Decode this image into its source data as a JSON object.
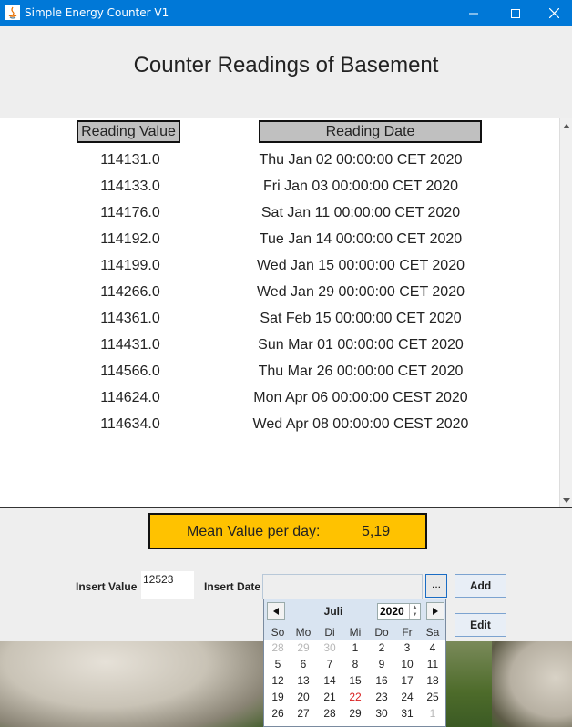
{
  "window": {
    "title": "Simple Energy Counter V1"
  },
  "header": {
    "title": "Counter Readings of Basement"
  },
  "table": {
    "headers": {
      "value": "Reading Value",
      "date": "Reading Date"
    },
    "rows": [
      {
        "value": "114131.0",
        "date": "Thu Jan 02 00:00:00 CET 2020"
      },
      {
        "value": "114133.0",
        "date": "Fri Jan 03 00:00:00 CET 2020"
      },
      {
        "value": "114176.0",
        "date": "Sat Jan 11 00:00:00 CET 2020"
      },
      {
        "value": "114192.0",
        "date": "Tue Jan 14 00:00:00 CET 2020"
      },
      {
        "value": "114199.0",
        "date": "Wed Jan 15 00:00:00 CET 2020"
      },
      {
        "value": "114266.0",
        "date": "Wed Jan 29 00:00:00 CET 2020"
      },
      {
        "value": "114361.0",
        "date": "Sat Feb 15 00:00:00 CET 2020"
      },
      {
        "value": "114431.0",
        "date": "Sun Mar 01 00:00:00 CET 2020"
      },
      {
        "value": "114566.0",
        "date": "Thu Mar 26 00:00:00 CET 2020"
      },
      {
        "value": "114624.0",
        "date": "Mon Apr 06 00:00:00 CEST 2020"
      },
      {
        "value": "114634.0",
        "date": "Wed Apr 08 00:00:00 CEST 2020"
      }
    ]
  },
  "mean": {
    "label": "Mean Value per day:",
    "value": "5,19",
    "color": "#ffc200"
  },
  "form": {
    "insert_value_label": "Insert Value",
    "insert_value": "12523",
    "insert_date_label": "Insert Date",
    "insert_date": "",
    "date_button_label": "...",
    "add_label": "Add",
    "edit_label": "Edit"
  },
  "calendar": {
    "month": "Juli",
    "year": "2020",
    "weekdays": [
      "So",
      "Mo",
      "Di",
      "Mi",
      "Do",
      "Fr",
      "Sa"
    ],
    "weeks": [
      [
        "28",
        "29",
        "30",
        "1",
        "2",
        "3",
        "4"
      ],
      [
        "5",
        "6",
        "7",
        "8",
        "9",
        "10",
        "11"
      ],
      [
        "12",
        "13",
        "14",
        "15",
        "16",
        "17",
        "18"
      ],
      [
        "19",
        "20",
        "21",
        "22",
        "23",
        "24",
        "25"
      ],
      [
        "26",
        "27",
        "28",
        "29",
        "30",
        "31",
        "1"
      ]
    ],
    "other_month_cells": [
      [
        0,
        0
      ],
      [
        0,
        1
      ],
      [
        0,
        2
      ],
      [
        4,
        6
      ]
    ],
    "today": "22",
    "today_color": "#d92020"
  },
  "colors": {
    "titlebar": "#0078d7",
    "header_bg": "#c0c0c0"
  }
}
